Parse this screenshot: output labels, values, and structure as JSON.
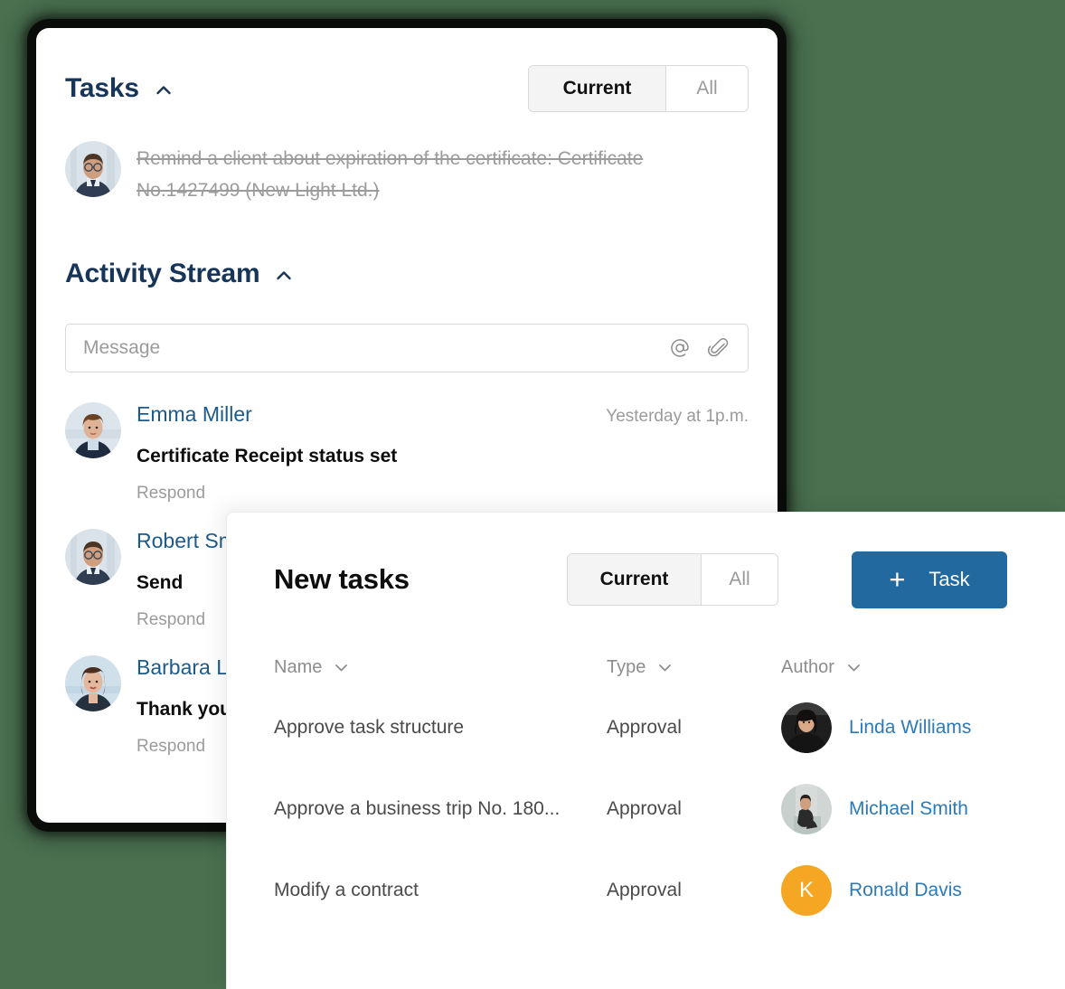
{
  "theme": {
    "background": "#4a7050",
    "accent_blue": "#21699f",
    "link_blue": "#2c7ab8",
    "name_blue": "#1b5a8a",
    "title_navy": "#173558",
    "avatar_orange": "#f5a623"
  },
  "tasks_panel": {
    "title": "Tasks",
    "collapse_icon": "chevron-up-icon",
    "toggle": {
      "active": "Current",
      "inactive": "All"
    },
    "completed_task": {
      "text": "Remind a client about expiration of the certificate: Certificate No.1427499 (New Light Ltd.)",
      "avatar": "avatar-photo-man-glasses"
    }
  },
  "activity_stream": {
    "title": "Activity Stream",
    "collapse_icon": "chevron-up-icon",
    "message_input": {
      "placeholder": "Message",
      "value": ""
    },
    "input_icons": [
      "mention-icon",
      "attachment-icon"
    ],
    "respond_label": "Respond",
    "entries": [
      {
        "author": "Emma Miller",
        "time": "Yesterday at 1p.m.",
        "message": "Certificate Receipt status set",
        "respond": "Respond",
        "avatar": "avatar-photo-woman-suit"
      },
      {
        "author": "Robert Smith",
        "time": "",
        "message": "Send",
        "respond": "Respond",
        "avatar": "avatar-photo-man-glasses"
      },
      {
        "author": "Barbara Lee",
        "time": "",
        "message": "Thank you",
        "respond": "Respond",
        "avatar": "avatar-photo-woman-dark-hair"
      }
    ]
  },
  "new_tasks_panel": {
    "title": "New tasks",
    "toggle": {
      "active": "Current",
      "inactive": "All"
    },
    "add_button": {
      "icon": "plus-icon",
      "label": "Task"
    },
    "columns": [
      {
        "label": "Name",
        "sort_icon": "chevron-down-icon"
      },
      {
        "label": "Type",
        "sort_icon": "chevron-down-icon"
      },
      {
        "label": "Author",
        "sort_icon": "chevron-down-icon"
      }
    ],
    "rows": [
      {
        "name": "Approve task structure",
        "type": "Approval",
        "author": "Linda  Williams",
        "avatar_kind": "photo",
        "avatar": "avatar-photo-woman-black-top"
      },
      {
        "name": "Approve a business trip No. 180...",
        "type": "Approval",
        "author": "Michael Smith",
        "avatar_kind": "photo",
        "avatar": "avatar-photo-man-seated"
      },
      {
        "name": "Modify a contract",
        "type": "Approval",
        "author": "Ronald Davis",
        "avatar_kind": "initial",
        "avatar_initial": "K"
      }
    ]
  }
}
